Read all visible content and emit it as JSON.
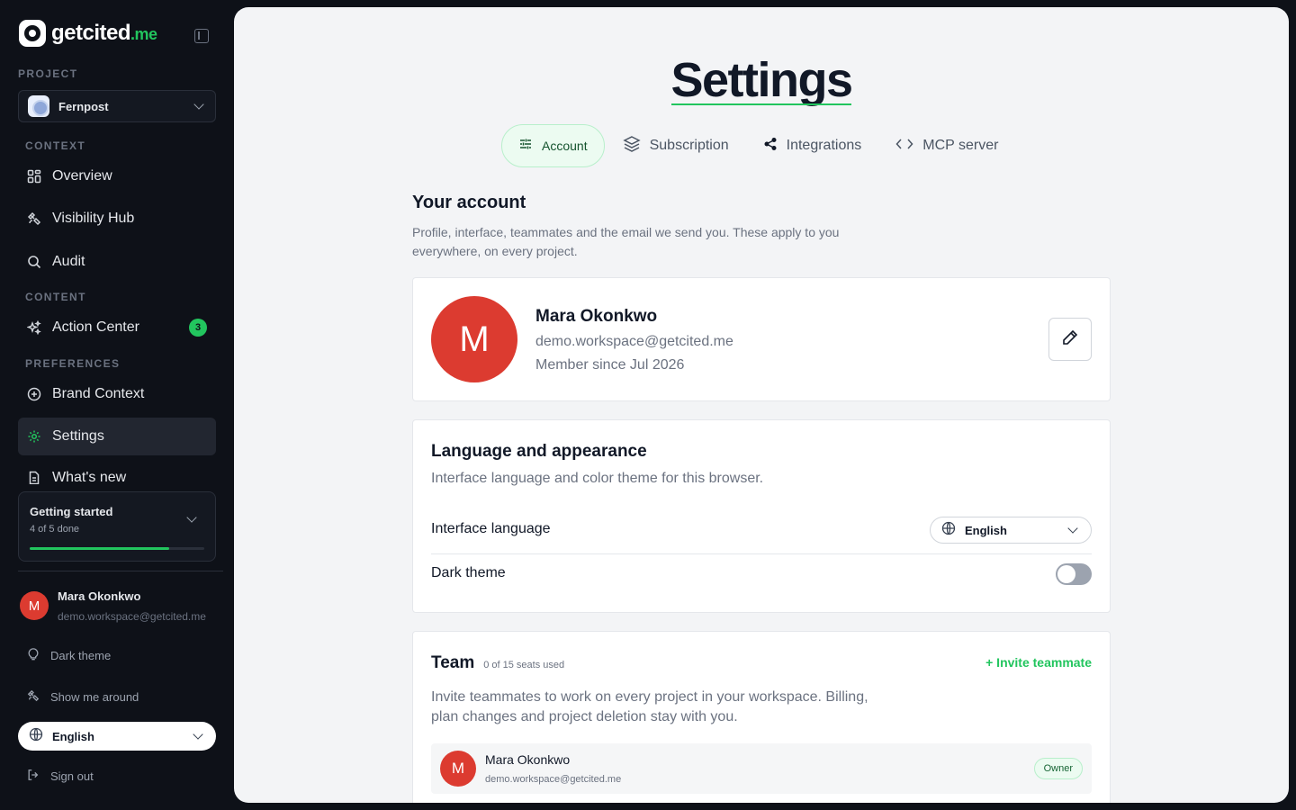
{
  "colors": {
    "accent": "#22c55e",
    "avatar": "#dc3b30",
    "sidebar_bg": "#0e1118"
  },
  "brand": {
    "name": "getcited",
    "tld": ".me"
  },
  "sidebar": {
    "project_label": "PROJECT",
    "project_name": "Fernpost",
    "sections": {
      "context": "CONTEXT",
      "content": "CONTENT",
      "preferences": "PREFERENCES"
    },
    "items": [
      {
        "label": "Overview",
        "icon": "grid-icon"
      },
      {
        "label": "Visibility Hub",
        "icon": "satellite-icon"
      },
      {
        "label": "Audit",
        "icon": "search-icon"
      },
      {
        "label": "Action Center",
        "icon": "sparkles-icon",
        "badge": "3"
      },
      {
        "label": "Brand Context",
        "icon": "plus-circle-icon"
      },
      {
        "label": "Settings",
        "icon": "gear-icon",
        "active": true
      },
      {
        "label": "What's new",
        "icon": "document-icon"
      }
    ],
    "getting_started": {
      "title": "Getting started",
      "progress_text": "4 of 5 done",
      "progress": 0.8
    },
    "user": {
      "initial": "M",
      "name": "Mara Okonkwo",
      "email": "demo.workspace@getcited.me"
    },
    "dark_theme_label": "Dark theme",
    "show_around_label": "Show me around",
    "language": "English",
    "sign_out_label": "Sign out"
  },
  "main": {
    "title": "Settings",
    "tabs": [
      {
        "label": "Account",
        "icon": "sliders-icon",
        "active": true
      },
      {
        "label": "Subscription",
        "icon": "layers-icon"
      },
      {
        "label": "Integrations",
        "icon": "share-icon"
      },
      {
        "label": "MCP server",
        "icon": "code-icon"
      }
    ],
    "account_heading": "Your account",
    "account_desc": "Profile, interface, teammates and the email we send you. These apply to you everywhere, on every project.",
    "profile": {
      "initial": "M",
      "name": "Mara Okonkwo",
      "email": "demo.workspace@getcited.me",
      "member_since": "Member since Jul 2026"
    },
    "appearance": {
      "heading": "Language and appearance",
      "desc": "Interface language and color theme for this browser.",
      "language_label": "Interface language",
      "language_value": "English",
      "dark_theme_label": "Dark theme",
      "dark_theme_on": false
    },
    "team": {
      "heading": "Team",
      "seats": "0 of 15 seats used",
      "invite_label": "+ Invite teammate",
      "desc": "Invite teammates to work on every project in your workspace. Billing, plan changes and project deletion stay with you.",
      "members": [
        {
          "initial": "M",
          "name": "Mara Okonkwo",
          "email": "demo.workspace@getcited.me",
          "role": "Owner"
        }
      ]
    }
  }
}
